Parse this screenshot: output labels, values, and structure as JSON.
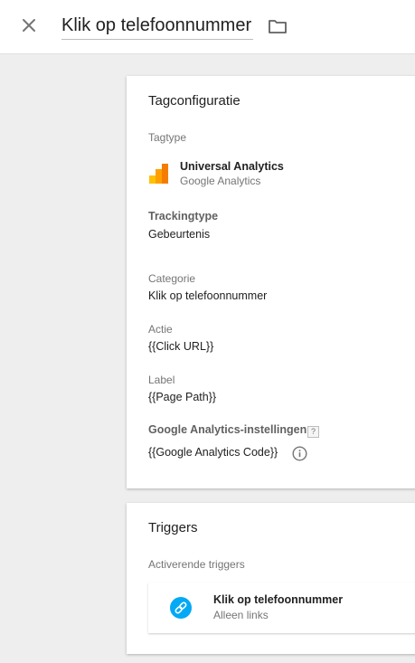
{
  "header": {
    "title": "Klik op telefoonnummer",
    "close_icon": "close-icon",
    "folder_icon": "folder-icon"
  },
  "tag_config": {
    "card_title": "Tagconfiguratie",
    "tag_type_label": "Tagtype",
    "tag_type_name": "Universal Analytics",
    "tag_type_vendor": "Google Analytics",
    "tag_type_icon": "google-analytics-icon",
    "tracking_type_label": "Trackingtype",
    "tracking_type_value": "Gebeurtenis",
    "category_label": "Categorie",
    "category_value": "Klik op telefoonnummer",
    "action_label": "Actie",
    "action_value": "{{Click URL}}",
    "label_label": "Label",
    "label_value": "{{Page Path}}",
    "ga_settings_label": "Google Analytics-instellingen",
    "ga_settings_help": "?",
    "ga_settings_value": "{{Google Analytics Code}}",
    "info_icon": "info-icon"
  },
  "triggers": {
    "card_title": "Triggers",
    "firing_label": "Activerende triggers",
    "items": [
      {
        "name": "Klik op telefoonnummer",
        "type": "Alleen links",
        "icon": "link-icon"
      }
    ]
  },
  "colors": {
    "ga_orange": "#f57c00",
    "ga_yellow": "#ffc107",
    "trigger_blue": "#03a9f4",
    "background": "#eeeeee"
  }
}
